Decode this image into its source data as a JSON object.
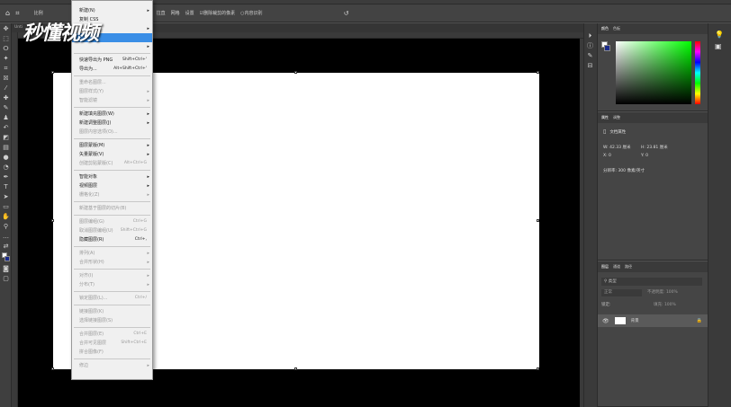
{
  "optionsbar": {
    "home_icon": "home-icon",
    "tool_icon": "crop-icon",
    "items": [
      "比例",
      "清除",
      "拉直",
      "网格",
      "设置",
      "删除裁剪的像素",
      "内容识别"
    ],
    "undo_icon": "undo-icon"
  },
  "canvas": {
    "tab_label": "Unti"
  },
  "layer_menu": {
    "items": [
      {
        "label": "新建(N)",
        "arrow": true
      },
      {
        "label": "复制 CSS"
      },
      {
        "label": "",
        "arrow": true
      },
      {
        "label": "",
        "highlight": true
      },
      {
        "label": "",
        "arrow": true
      },
      {
        "sep": true
      },
      {
        "label": "快速导出为 PNG",
        "shortcut": "Shift+Ctrl+'"
      },
      {
        "label": "导出为...",
        "shortcut": "Alt+Shift+Ctrl+'"
      },
      {
        "sep": true
      },
      {
        "label": "重命名图层...",
        "disabled": true
      },
      {
        "label": "图层样式(Y)",
        "arrow": true,
        "disabled": true
      },
      {
        "label": "智能滤镜",
        "arrow": true,
        "disabled": true
      },
      {
        "sep": true
      },
      {
        "label": "新建填充图层(W)",
        "arrow": true
      },
      {
        "label": "新建调整图层(J)",
        "arrow": true
      },
      {
        "label": "图层内容选项(O)...",
        "disabled": true
      },
      {
        "sep": true
      },
      {
        "label": "图层蒙版(M)",
        "arrow": true
      },
      {
        "label": "矢量蒙版(V)",
        "arrow": true
      },
      {
        "label": "创建剪贴蒙版(C)",
        "shortcut": "Alt+Ctrl+G",
        "disabled": true
      },
      {
        "sep": true
      },
      {
        "label": "智能对象",
        "arrow": true
      },
      {
        "label": "视频图层",
        "arrow": true
      },
      {
        "label": "栅格化(Z)",
        "arrow": true,
        "disabled": true
      },
      {
        "sep": true
      },
      {
        "label": "新建基于图层的切片(B)",
        "disabled": true
      },
      {
        "sep": true
      },
      {
        "label": "图层编组(G)",
        "shortcut": "Ctrl+G",
        "disabled": true
      },
      {
        "label": "取消图层编组(U)",
        "shortcut": "Shift+Ctrl+G",
        "disabled": true
      },
      {
        "label": "隐藏图层(R)",
        "shortcut": "Ctrl+,"
      },
      {
        "sep": true
      },
      {
        "label": "排列(A)",
        "arrow": true,
        "disabled": true
      },
      {
        "label": "合并形状(H)",
        "arrow": true,
        "disabled": true
      },
      {
        "sep": true
      },
      {
        "label": "对齐(I)",
        "arrow": true,
        "disabled": true
      },
      {
        "label": "分布(T)",
        "arrow": true,
        "disabled": true
      },
      {
        "sep": true
      },
      {
        "label": "锁定图层(L)...",
        "shortcut": "Ctrl+/",
        "disabled": true
      },
      {
        "sep": true
      },
      {
        "label": "链接图层(K)",
        "disabled": true
      },
      {
        "label": "选择链接图层(S)",
        "disabled": true
      },
      {
        "sep": true
      },
      {
        "label": "合并图层(E)",
        "shortcut": "Ctrl+E",
        "disabled": true
      },
      {
        "label": "合并可见图层",
        "shortcut": "Shift+Ctrl+E",
        "disabled": true
      },
      {
        "label": "拼合图像(F)",
        "disabled": true
      },
      {
        "sep": true
      },
      {
        "label": "修边",
        "arrow": true,
        "disabled": true
      }
    ]
  },
  "color_panel": {
    "tabs": [
      "颜色",
      "色板"
    ]
  },
  "properties_panel": {
    "tabs": [
      "属性",
      "调整"
    ],
    "doc_label": "文档属性",
    "w_label": "W: 42.33 厘米",
    "h_label": "H: 23.81 厘米",
    "x_label": "X: 0",
    "y_label": "Y: 0",
    "res_label": "分辨率: 300 像素/英寸"
  },
  "layers_panel": {
    "tabs": [
      "图层",
      "通道",
      "路径"
    ],
    "kind_label": "类型",
    "mode_label": "正常",
    "opacity_label": "不透明度: 100%",
    "lock_label": "锁定:",
    "fill_label": "填充: 100%",
    "layer_name": "背景"
  },
  "watermark": "秒懂视频",
  "colors": {
    "highlight": "#3a8ee6",
    "canvas_bg": "#000000"
  }
}
